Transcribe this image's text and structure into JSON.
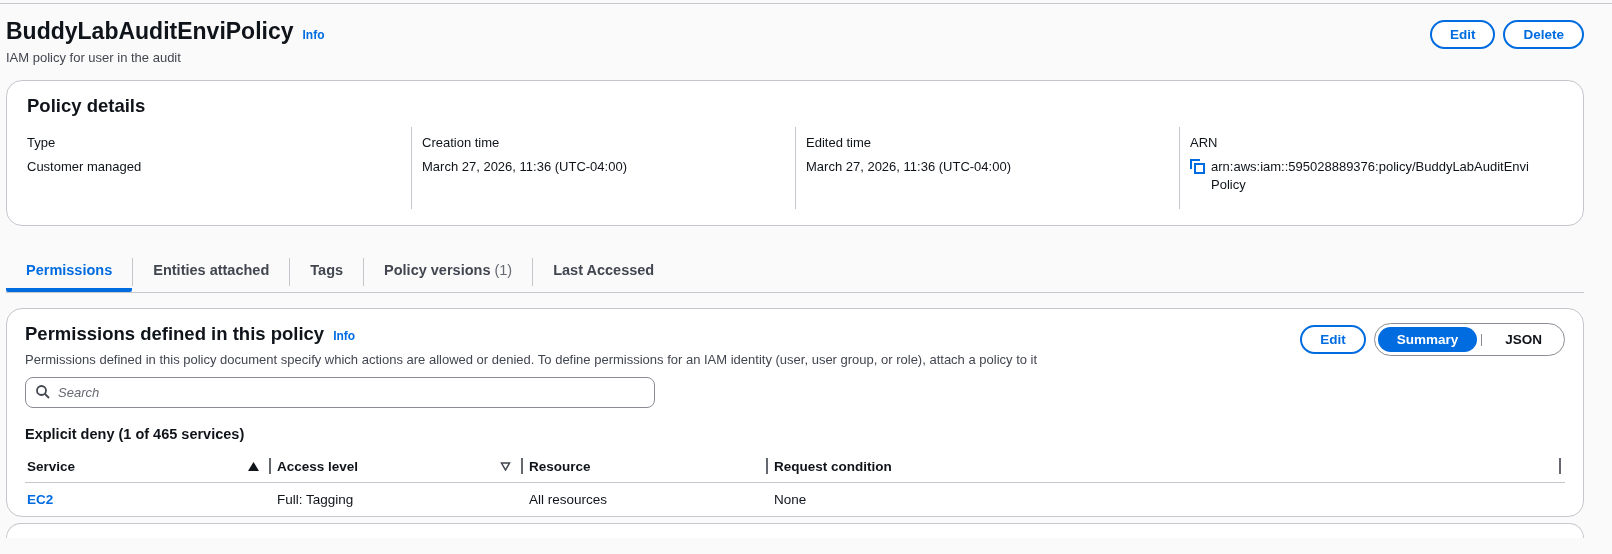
{
  "header": {
    "title": "BuddyLabAuditEnviPolicy",
    "info": "Info",
    "description": "IAM policy for user in the audit",
    "buttons": [
      "Edit",
      "Delete"
    ]
  },
  "policy_details": {
    "title": "Policy details",
    "fields": [
      {
        "label": "Type",
        "value": "Customer managed"
      },
      {
        "label": "Creation time",
        "value": "March 27, 2026, 11:36 (UTC-04:00)"
      },
      {
        "label": "Edited time",
        "value": "March 27, 2026, 11:36 (UTC-04:00)"
      },
      {
        "label": "ARN",
        "value": "arn:aws:iam::595028889376:policy/BuddyLabAuditEnviPolicy",
        "kind": "copy"
      }
    ]
  },
  "tabs": [
    {
      "label": "Permissions",
      "selected": true
    },
    {
      "label": "Entities attached",
      "selected": false
    },
    {
      "label": "Tags",
      "selected": false
    },
    {
      "label": "Policy versions",
      "count": "(1)",
      "selected": false
    },
    {
      "label": "Last Accessed",
      "selected": false
    }
  ],
  "permissions": {
    "title": "Permissions defined in this policy",
    "info": "Info",
    "description": "Permissions defined in this policy document specify which actions are allowed or denied. To define permissions for an IAM identity (user, user group, or role), attach a policy to it",
    "edit_button": "Edit",
    "view_toggle": [
      {
        "label": "Summary",
        "selected": true
      },
      {
        "label": "JSON",
        "selected": false
      }
    ],
    "search": {
      "placeholder": "Search"
    },
    "section_title": "Explicit deny (1 of 465 services)",
    "table": {
      "columns": [
        {
          "label": "Service",
          "sortable": true,
          "sorted": true
        },
        {
          "label": "Access level",
          "sortable": true,
          "sorted": false
        },
        {
          "label": "Resource"
        },
        {
          "label": "Request condition"
        }
      ],
      "rows": [
        [
          "EC2",
          "Full: Tagging",
          "All resources",
          "None"
        ]
      ]
    }
  }
}
